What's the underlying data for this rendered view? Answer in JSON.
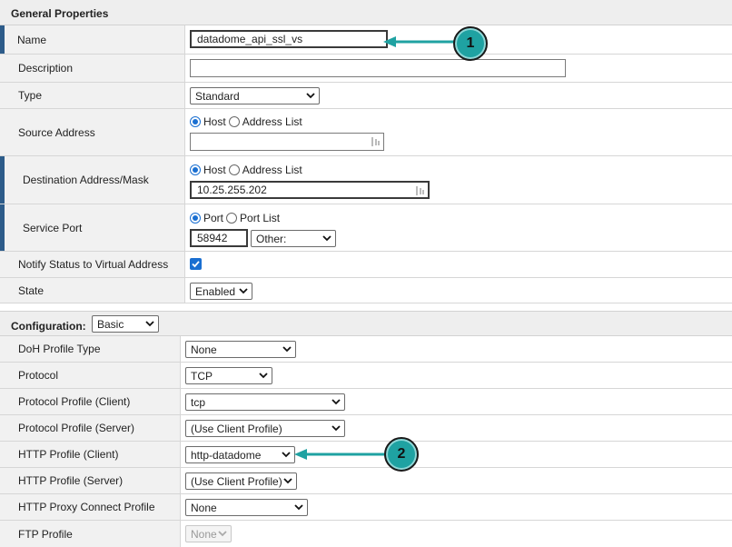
{
  "general": {
    "title": "General Properties",
    "name": {
      "label": "Name",
      "value": "datadome_api_ssl_vs"
    },
    "description": {
      "label": "Description",
      "value": ""
    },
    "type": {
      "label": "Type",
      "value": "Standard"
    },
    "source": {
      "label": "Source Address",
      "opt_host": "Host",
      "opt_list": "Address List",
      "value": ""
    },
    "destination": {
      "label": "Destination Address/Mask",
      "opt_host": "Host",
      "opt_list": "Address List",
      "value": "10.25.255.202"
    },
    "service_port": {
      "label": "Service Port",
      "opt_port": "Port",
      "opt_list": "Port List",
      "value": "58942",
      "preset": "Other:"
    },
    "notify": {
      "label": "Notify Status to Virtual Address",
      "checked": true
    },
    "state": {
      "label": "State",
      "value": "Enabled"
    }
  },
  "configuration": {
    "title": "Configuration:",
    "mode": "Basic",
    "rows": [
      {
        "label": "DoH Profile Type",
        "value": "None"
      },
      {
        "label": "Protocol",
        "value": "TCP"
      },
      {
        "label": "Protocol Profile (Client)",
        "value": "tcp"
      },
      {
        "label": "Protocol Profile (Server)",
        "value": "(Use Client Profile)"
      },
      {
        "label": "HTTP Profile (Client)",
        "value": "http-datadome"
      },
      {
        "label": "HTTP Profile (Server)",
        "value": "(Use Client Profile)"
      },
      {
        "label": "HTTP Proxy Connect Profile",
        "value": "None"
      },
      {
        "label": "FTP Profile",
        "value": "None"
      }
    ]
  },
  "callouts": {
    "first": "1",
    "second": "2"
  },
  "colors": {
    "accent": "#2d5c8a",
    "callout": "#1fa2a2",
    "checkbox": "#1a6fd1"
  }
}
